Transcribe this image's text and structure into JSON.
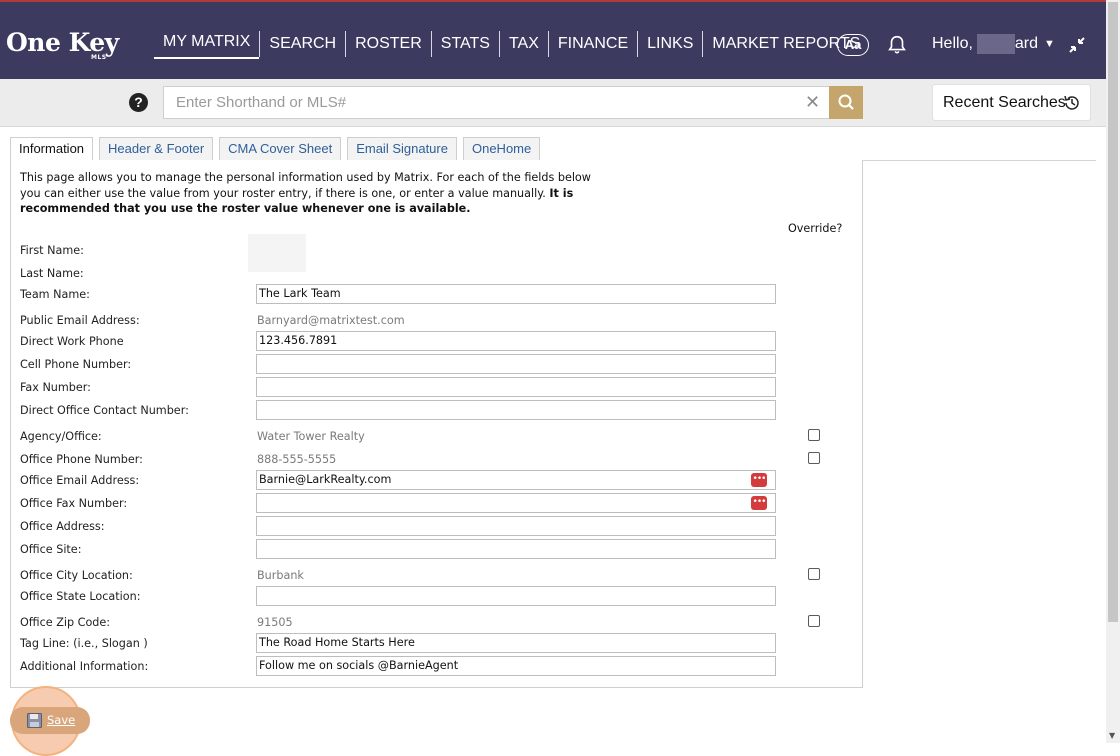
{
  "app": {
    "logo_text": "One Key",
    "logo_sub": "MLS"
  },
  "nav": {
    "items": [
      {
        "label": "MY MATRIX",
        "active": true
      },
      {
        "label": "SEARCH"
      },
      {
        "label": "ROSTER"
      },
      {
        "label": "STATS"
      },
      {
        "label": "TAX"
      },
      {
        "label": "FINANCE"
      },
      {
        "label": "LINKS"
      },
      {
        "label": "MARKET REPORTS"
      }
    ],
    "font_button_label": "Aa",
    "hello_prefix": "Hello,",
    "hello_suffix": "ard",
    "bell_icon": "bell-icon",
    "collapse_icon": "collapse-arrows-icon"
  },
  "search": {
    "placeholder": "Enter Shorthand or MLS#",
    "value": "",
    "clear_icon": "close-icon",
    "go_icon": "magnifier-icon",
    "help_label": "?",
    "recent_label": "Recent Searches",
    "recent_icon": "history-icon",
    "accent_color": "#c4a56b"
  },
  "tabs": [
    {
      "label": "Information",
      "active": true
    },
    {
      "label": "Header & Footer"
    },
    {
      "label": "CMA Cover Sheet"
    },
    {
      "label": "Email Signature"
    },
    {
      "label": "OneHome"
    }
  ],
  "intro": {
    "text": "This page allows you to manage the personal information used by Matrix. For each of the fields below you can either use the value from your roster entry, if there is one, or enter a value manually.",
    "bold_text": "It is recommended that you use the roster value whenever one is available."
  },
  "override_label": "Override?",
  "form": {
    "first_name": {
      "label": "First Name:",
      "value": ""
    },
    "last_name": {
      "label": "Last Name:",
      "value": ""
    },
    "team_name": {
      "label": "Team Name:",
      "value": "The Lark Team"
    },
    "public_email": {
      "label": "Public Email Address:",
      "value": "Barnyard@matrixtest.com"
    },
    "direct_work_phone": {
      "label": "Direct Work Phone",
      "value": "123.456.7891"
    },
    "cell_phone": {
      "label": "Cell Phone Number:",
      "value": ""
    },
    "fax": {
      "label": "Fax Number:",
      "value": ""
    },
    "direct_office_contact": {
      "label": "Direct Office Contact Number:",
      "value": ""
    },
    "agency_office": {
      "label": "Agency/Office:",
      "value": "Water Tower Realty",
      "override": false
    },
    "office_phone": {
      "label": "Office Phone Number:",
      "value": "888-555-5555",
      "override": false
    },
    "office_email": {
      "label": "Office Email Address:",
      "value": "Barnie@LarkRealty.com"
    },
    "office_fax": {
      "label": "Office Fax Number:",
      "value": ""
    },
    "office_address": {
      "label": "Office Address:",
      "value": ""
    },
    "office_site": {
      "label": "Office Site:",
      "value": ""
    },
    "office_city": {
      "label": "Office City Location:",
      "value": "Burbank",
      "override": false
    },
    "office_state": {
      "label": "Office State Location:",
      "value": ""
    },
    "office_zip": {
      "label": "Office Zip Code:",
      "value": "91505",
      "override": false
    },
    "tag_line": {
      "label": "Tag Line: (i.e., Slogan )",
      "value": "The Road Home Starts Here"
    },
    "additional_info": {
      "label": "Additional Information:",
      "value": "Follow me on socials @BarnieAgent"
    }
  },
  "save": {
    "label": "Save",
    "icon": "floppy-disk-icon"
  },
  "colors": {
    "nav_bg": "#3d3a60",
    "link": "#2d5f9a",
    "password_manager": "#d23c3c"
  }
}
